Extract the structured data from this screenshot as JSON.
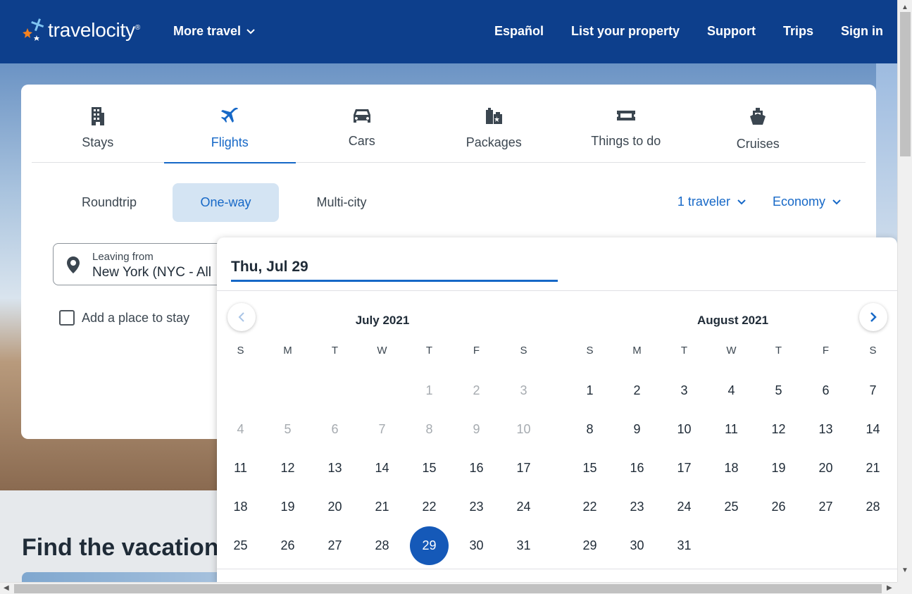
{
  "header": {
    "logo_text": "travelocity",
    "logo_mark": "®",
    "more_travel": "More travel",
    "nav": [
      "Español",
      "List your property",
      "Support",
      "Trips",
      "Sign in"
    ]
  },
  "tabs": [
    {
      "label": "Stays",
      "icon": "building-icon"
    },
    {
      "label": "Flights",
      "icon": "airplane-icon",
      "active": true
    },
    {
      "label": "Cars",
      "icon": "car-icon"
    },
    {
      "label": "Packages",
      "icon": "suitcase-icon"
    },
    {
      "label": "Things to do",
      "icon": "ticket-icon"
    },
    {
      "label": "Cruises",
      "icon": "ship-icon"
    }
  ],
  "trip_types": {
    "roundtrip": "Roundtrip",
    "oneway": "One-way",
    "multicity": "Multi-city",
    "selected": "One-way"
  },
  "travelers": "1 traveler",
  "cabin_class": "Economy",
  "leaving": {
    "label": "Leaving from",
    "value": "New York (NYC - All"
  },
  "add_stay": "Add a place to stay",
  "date_field": "Thu, Jul 29",
  "calendar": {
    "weekdays": [
      "S",
      "M",
      "T",
      "W",
      "T",
      "F",
      "S"
    ],
    "months": [
      {
        "title": "July 2021",
        "weeks": [
          [
            "",
            "",
            "",
            "",
            "1",
            "2",
            "3"
          ],
          [
            "4",
            "5",
            "6",
            "7",
            "8",
            "9",
            "10"
          ],
          [
            "11",
            "12",
            "13",
            "14",
            "15",
            "16",
            "17"
          ],
          [
            "18",
            "19",
            "20",
            "21",
            "22",
            "23",
            "24"
          ],
          [
            "25",
            "26",
            "27",
            "28",
            "29",
            "30",
            "31"
          ]
        ],
        "disabled_through": 10,
        "selected": "29"
      },
      {
        "title": "August 2021",
        "weeks": [
          [
            "1",
            "2",
            "3",
            "4",
            "5",
            "6",
            "7"
          ],
          [
            "8",
            "9",
            "10",
            "11",
            "12",
            "13",
            "14"
          ],
          [
            "15",
            "16",
            "17",
            "18",
            "19",
            "20",
            "21"
          ],
          [
            "22",
            "23",
            "24",
            "25",
            "26",
            "27",
            "28"
          ],
          [
            "29",
            "30",
            "31",
            "",
            "",
            "",
            ""
          ]
        ],
        "disabled_through": 0,
        "selected": ""
      }
    ]
  },
  "find_heading": "Find the vacation",
  "colors": {
    "brand": "#0d3f8c",
    "accent": "#1668c7",
    "selected_day": "#1559b8",
    "selected_trip_bg": "#d4e4f3"
  }
}
